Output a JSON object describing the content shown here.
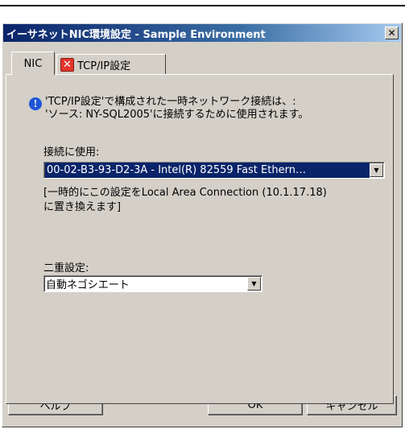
{
  "window": {
    "title": "イーサネットNIC環境設定 - Sample Environment",
    "close_glyph": "✕"
  },
  "tabs": [
    {
      "label": "NIC",
      "active": true
    },
    {
      "label": "TCP/IP設定",
      "active": false,
      "icon": "error-x-icon",
      "icon_glyph": "✕",
      "icon_color": "#e2352b"
    }
  ],
  "info": {
    "icon": "info-icon",
    "icon_glyph": "!",
    "line1": "'TCP/IP設定'で構成された一時ネットワーク接続は、:",
    "line2": "'ソース: NY-SQL2005'に接続するために使用されます。"
  },
  "connection": {
    "label": "接続に使用:",
    "value": "00-02-B3-93-D2-3A - Intel(R) 82559 Fast Ethern…",
    "note_line1": "[一時的にこの設定をLocal Area Connection (10.1.17.18)",
    "note_line2": "に置き換えます]"
  },
  "duplex": {
    "label": "二重設定:",
    "value": "自動ネゴシエート"
  },
  "buttons": {
    "help": "ヘルプ",
    "ok": "OK",
    "cancel": "キャンセル"
  },
  "colors": {
    "titlebar": "#0a246a",
    "selection": "#0a246a",
    "face": "#d4d0c8",
    "info_icon": "#1f56d8"
  }
}
